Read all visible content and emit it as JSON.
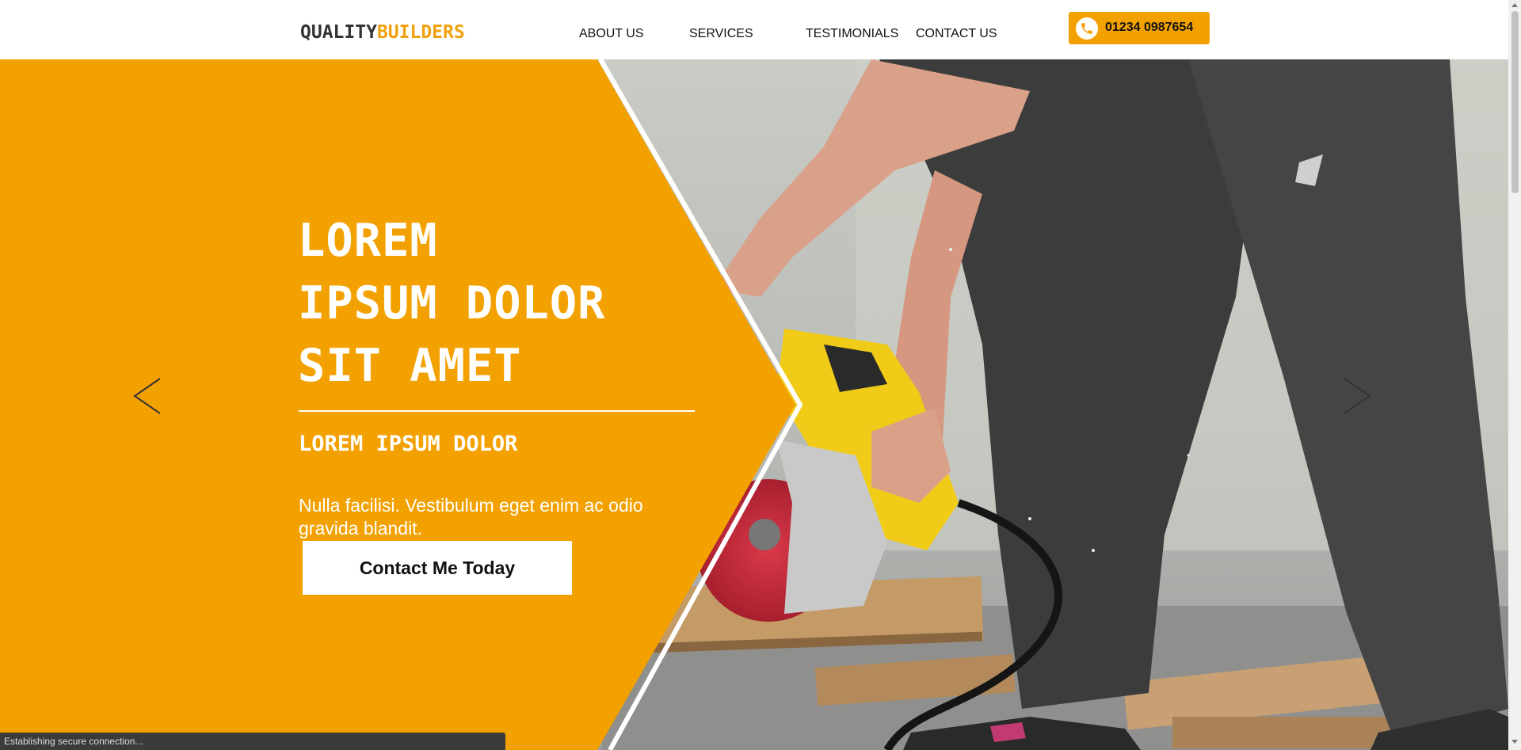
{
  "header": {
    "logo": {
      "part1": "QUALITY",
      "part2": "BUILDERS"
    },
    "nav": [
      {
        "label": "ABOUT US"
      },
      {
        "label": "SERVICES"
      },
      {
        "label": "TESTIMONIALS"
      },
      {
        "label": "CONTACT US"
      }
    ],
    "phone": {
      "icon": "phone-icon",
      "number": "01234 0987654"
    }
  },
  "hero": {
    "headline": [
      "LOREM",
      "IPSUM DOLOR",
      "SIT AMET"
    ],
    "subheading": "LOREM IPSUM DOLOR",
    "body": "Nulla facilisi. Vestibulum eget enim ac odio gravida blandit.",
    "cta": "Contact Me Today",
    "prev_icon": "chevron-left-icon",
    "next_icon": "chevron-right-icon"
  },
  "status": {
    "text": "Establishing secure connection..."
  },
  "colors": {
    "accent": "#f3a100",
    "text_dark": "#111111",
    "white": "#ffffff"
  }
}
